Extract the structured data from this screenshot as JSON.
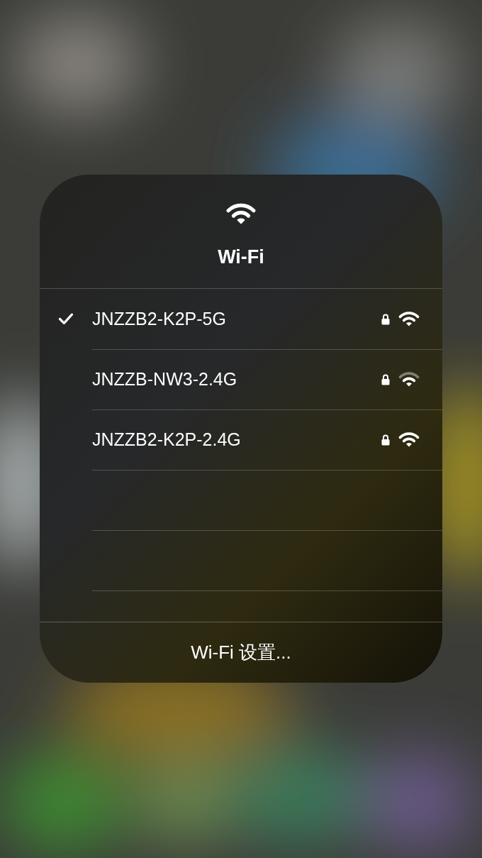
{
  "panel": {
    "title": "Wi-Fi"
  },
  "networks": [
    {
      "name": "JNZZB2-K2P-5G",
      "selected": true,
      "locked": true,
      "kind": "strong"
    },
    {
      "name": "JNZZB-NW3-2.4G",
      "selected": false,
      "locked": true,
      "kind": "medium"
    },
    {
      "name": "JNZZB2-K2P-2.4G",
      "selected": false,
      "locked": true,
      "kind": "strong"
    }
  ],
  "settings_button": "Wi-Fi 设置..."
}
